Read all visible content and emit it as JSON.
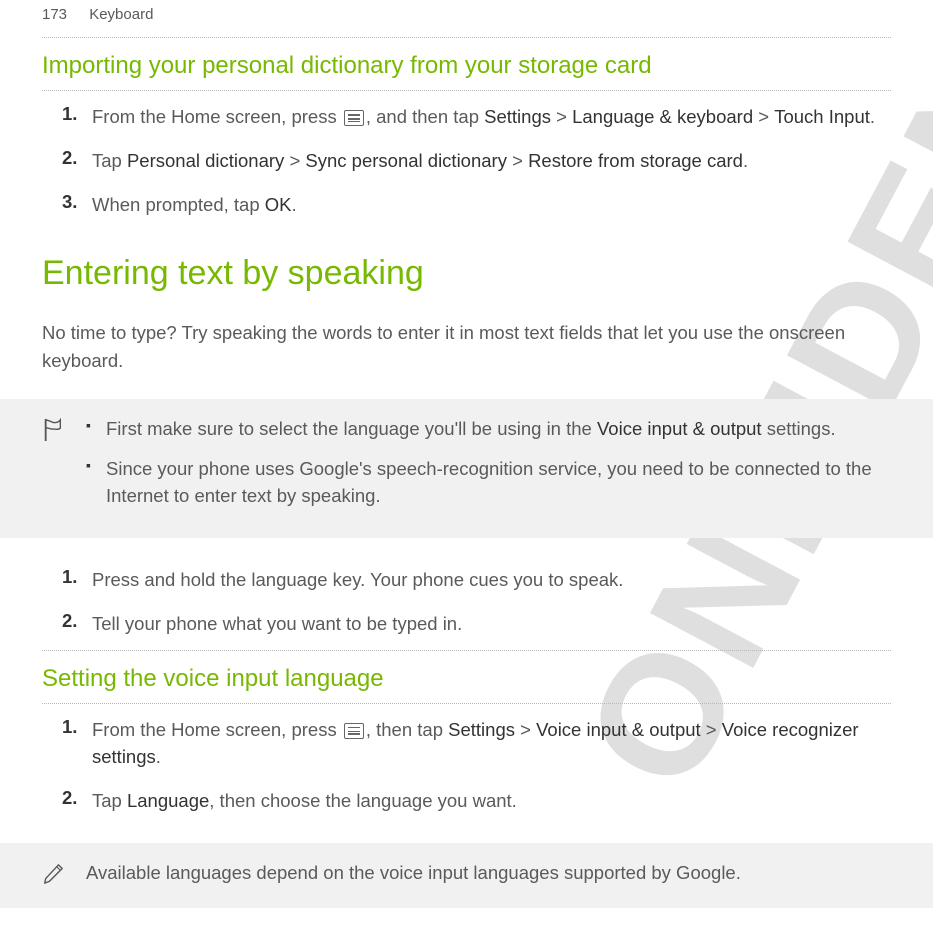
{
  "header": {
    "page": "173",
    "section": "Keyboard"
  },
  "sec1": {
    "title": "Importing your personal dictionary from your storage card",
    "steps": {
      "n1": "1.",
      "s1a": "From the Home screen, press ",
      "s1b": ", and then tap ",
      "s1c": "Settings",
      "s1d": " > ",
      "s1e": "Language & keyboard",
      "s1f": " > ",
      "s1g": "Touch Input",
      "s1h": ".",
      "n2": "2.",
      "s2a": "Tap ",
      "s2b": "Personal dictionary",
      "s2c": " > ",
      "s2d": "Sync personal dictionary",
      "s2e": " > ",
      "s2f": "Restore from storage card",
      "s2g": ".",
      "n3": "3.",
      "s3a": "When prompted, tap ",
      "s3b": "OK",
      "s3c": "."
    }
  },
  "sec2": {
    "title": "Entering text by speaking",
    "intro": "No time to type? Try speaking the words to enter it in most text fields that let you use the onscreen keyboard.",
    "note": {
      "b1a": "First make sure to select the language you'll be using in the ",
      "b1b": "Voice input & output",
      "b1c": " settings.",
      "b2": "Since your phone uses Google's speech-recognition service, you need to be connected to the Internet to enter text by speaking."
    },
    "steps": {
      "n1": "1.",
      "s1": "Press and hold the language key. Your phone cues you to speak.",
      "n2": "2.",
      "s2": "Tell your phone what you want to be typed in."
    }
  },
  "sec3": {
    "title": "Setting the voice input language",
    "steps": {
      "n1": "1.",
      "s1a": "From the Home screen, press ",
      "s1b": ", then tap ",
      "s1c": "Settings",
      "s1d": " > ",
      "s1e": "Voice input & output",
      "s1f": " > ",
      "s1g": "Voice recognizer settings",
      "s1h": ".",
      "n2": "2.",
      "s2a": "Tap ",
      "s2b": "Language",
      "s2c": ", then choose the language you want."
    },
    "footnote": "Available languages depend on the voice input languages supported by Google."
  }
}
